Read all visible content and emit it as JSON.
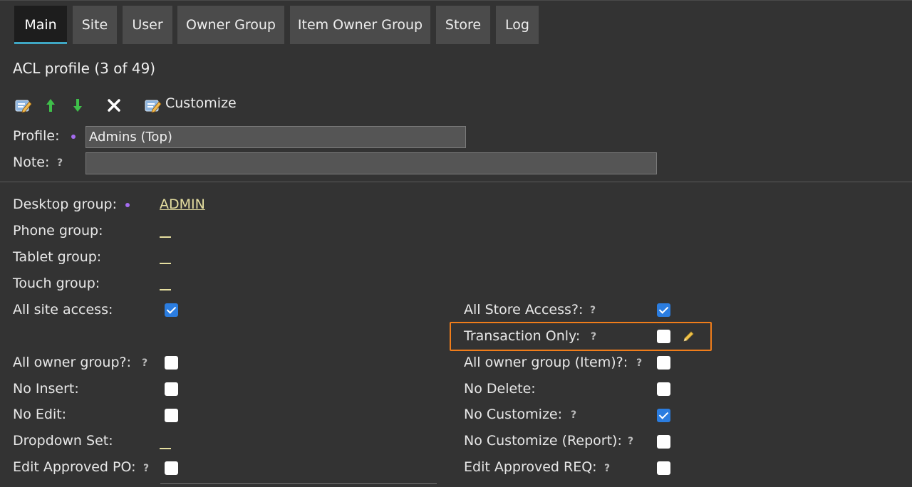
{
  "tabs": [
    {
      "label": "Main"
    },
    {
      "label": "Site"
    },
    {
      "label": "User"
    },
    {
      "label": "Owner Group"
    },
    {
      "label": "Item Owner Group"
    },
    {
      "label": "Store"
    },
    {
      "label": "Log"
    }
  ],
  "active_tab": "Main",
  "title": "ACL profile (3 of 49)",
  "toolbar": {
    "icons": [
      "edit-icon",
      "arrow-up-icon",
      "arrow-down-icon",
      "delete-icon",
      "customize-icon"
    ],
    "customize_label": "Customize"
  },
  "form": {
    "profile_label": "Profile:",
    "profile_value": "Admins (Top)",
    "note_label": "Note:",
    "note_value": "",
    "help_glyph": "?"
  },
  "groups": {
    "desktop_label": "Desktop group:",
    "desktop_value": "ADMIN",
    "phone_label": "Phone group:",
    "tablet_label": "Tablet group:",
    "touch_label": "Touch group:"
  },
  "left_fields": {
    "all_site_access": {
      "label": "All site access:",
      "checked": true
    },
    "all_owner_group": {
      "label": "All owner group?:",
      "checked": false
    },
    "no_insert": {
      "label": "No Insert:",
      "checked": false
    },
    "no_edit": {
      "label": "No Edit:",
      "checked": false
    },
    "dropdown_set": {
      "label": "Dropdown Set:"
    },
    "edit_approved_po": {
      "label": "Edit Approved PO:",
      "checked": false
    }
  },
  "right_fields": {
    "all_store_access": {
      "label": "All Store Access?:",
      "checked": true
    },
    "transaction_only": {
      "label": "Transaction Only:",
      "checked": false
    },
    "all_owner_group_item": {
      "label": "All owner group (Item)?:",
      "checked": false
    },
    "no_delete": {
      "label": "No Delete:",
      "checked": false
    },
    "no_customize": {
      "label": "No Customize:",
      "checked": true
    },
    "no_customize_report": {
      "label": "No Customize (Report):",
      "checked": false
    },
    "edit_approved_req": {
      "label": "Edit Approved REQ:",
      "checked": false
    }
  },
  "colors": {
    "background": "#333333",
    "tab": "#4b4b4b",
    "tab_active": "#1d1d1d",
    "tab_accent": "#3fa7c4",
    "link": "#e6dfa0",
    "checkbox_checked": "#2b7de0",
    "highlight": "#f07d1a",
    "required_dot": "#a56cf0"
  }
}
